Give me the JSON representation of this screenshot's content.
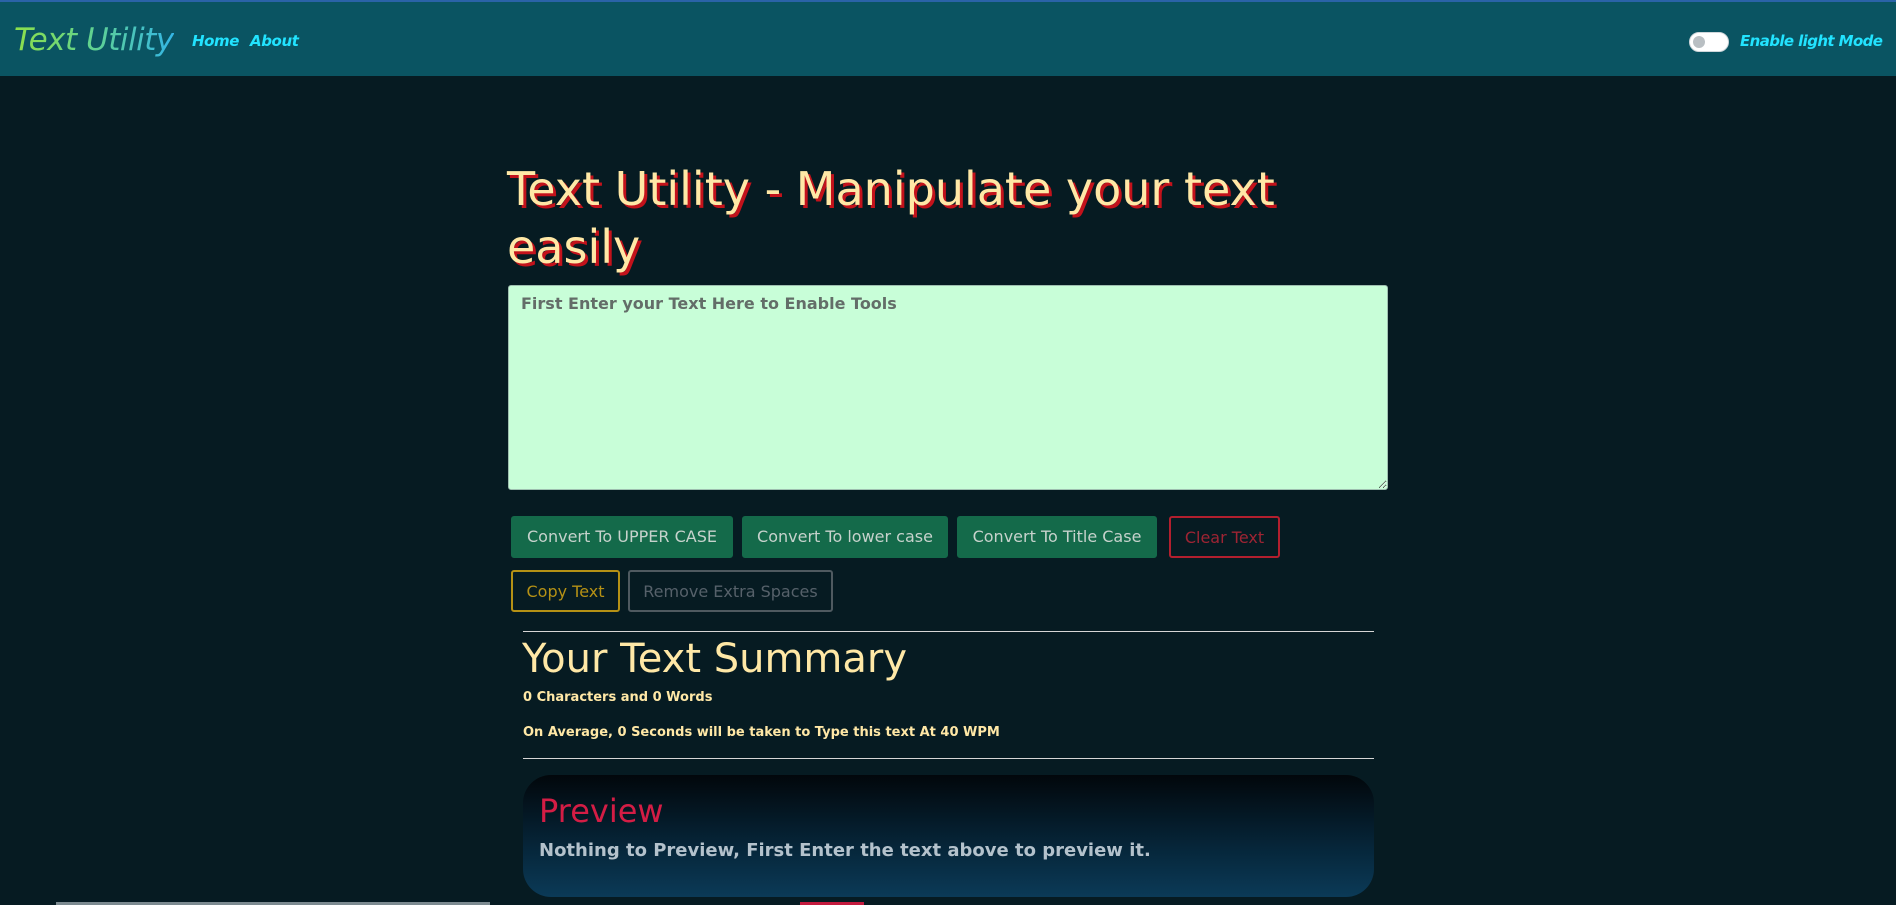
{
  "navbar": {
    "brand": "Text Utility",
    "links": [
      {
        "label": "Home"
      },
      {
        "label": "About"
      }
    ],
    "mode_toggle_label": "Enable light Mode"
  },
  "main": {
    "heading": "Text Utility - Manipulate your text easily",
    "textarea_placeholder": "First Enter your Text Here to Enable Tools",
    "textarea_value": "",
    "buttons": {
      "upper": "Convert To UPPER CASE",
      "lower": "Convert To lower case",
      "title": "Convert To Title Case",
      "clear": "Clear Text",
      "copy": "Copy Text",
      "remove_spaces": "Remove Extra Spaces"
    }
  },
  "summary": {
    "title": "Your Text Summary",
    "counts": "0 Characters and 0 Words",
    "reading_time": "On Average, 0 Seconds will be taken to Type this text At 40 WPM"
  },
  "preview": {
    "title": "Preview",
    "text": "Nothing to Preview, First Enter the text above to preview it."
  },
  "colors": {
    "navbar_bg": "#0a5462",
    "page_bg": "#061b22",
    "heading": "#ffe8a6",
    "heading_shadow": "#c3121b",
    "nav_link": "#22e3ff",
    "textarea_bg": "#c8fed8",
    "button_green": "#146a4a",
    "danger": "#b21f2e",
    "warning": "#b59115",
    "preview_title": "#d41d45"
  }
}
